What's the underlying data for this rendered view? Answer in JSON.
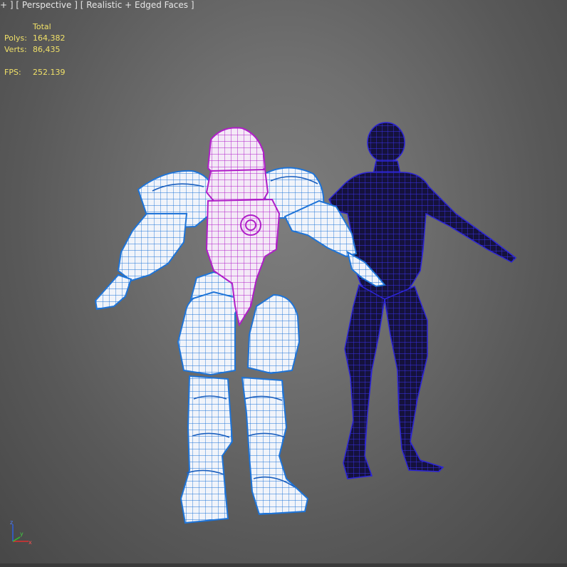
{
  "viewport": {
    "menu_plus": "+",
    "view_label": "Perspective",
    "shading_label": "Realistic + Edged Faces"
  },
  "stats": {
    "header": "Total",
    "polys_label": "Polys:",
    "polys_value": "164,382",
    "verts_label": "Verts:",
    "verts_value": "86,435",
    "fps_label": "FPS:",
    "fps_value": "252.139"
  },
  "gizmo": {
    "x": "x",
    "y": "y",
    "z": "z"
  },
  "colors": {
    "armor_wire": "#1e74d8",
    "armor_fill": "#eef2f8",
    "torso_wire": "#b01ec8",
    "body_wire": "#2c24d8",
    "body_fill": "#141240",
    "stats_text": "#f0e068",
    "label_text": "#e6e6e6"
  },
  "objects": [
    "armored-character-mesh",
    "base-body-mesh"
  ]
}
